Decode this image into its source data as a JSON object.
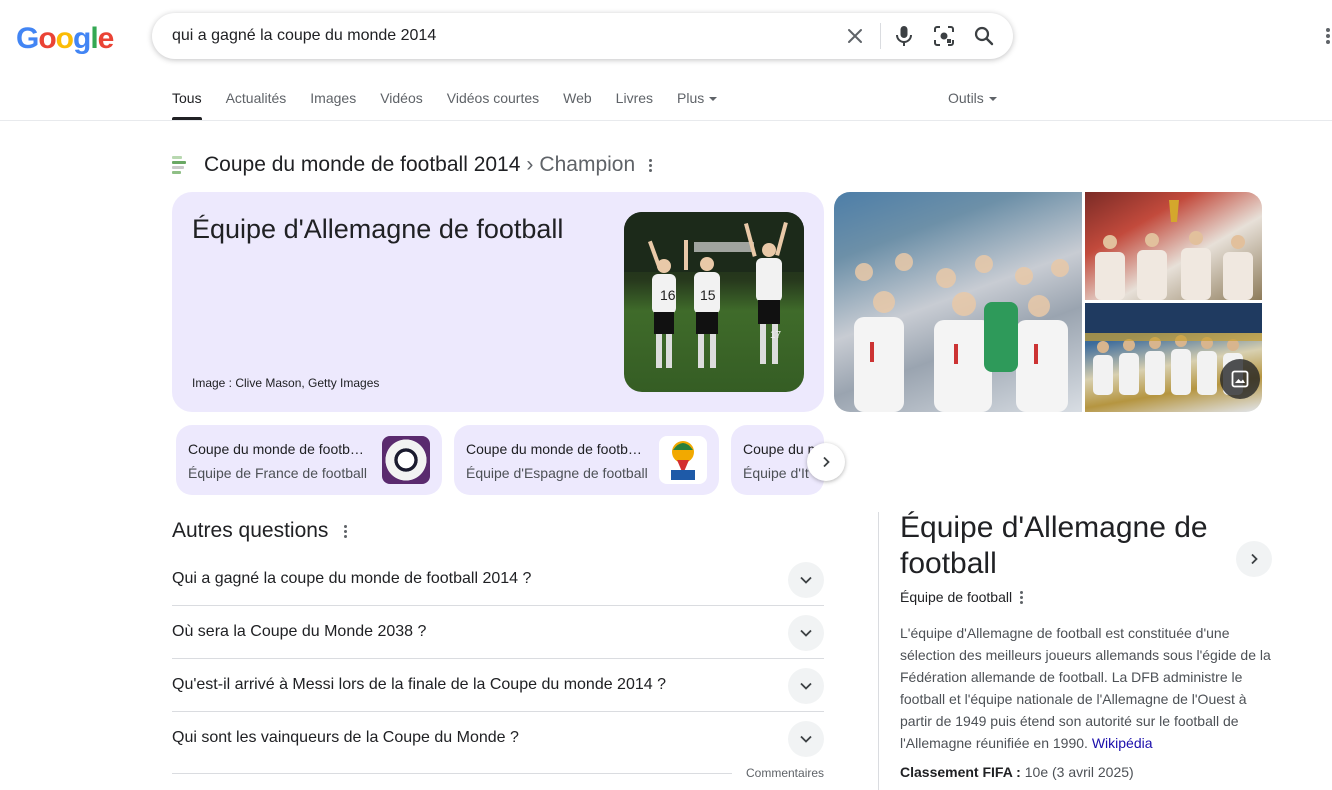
{
  "logo": {
    "letters": [
      "G",
      "o",
      "o",
      "g",
      "l",
      "e"
    ],
    "colors": [
      "#4285f4",
      "#ea4335",
      "#fbbc05",
      "#4285f4",
      "#34a853",
      "#ea4335"
    ]
  },
  "search": {
    "query": "qui a gagné la coupe du monde 2014"
  },
  "tabs": [
    {
      "label": "Tous",
      "active": true
    },
    {
      "label": "Actualités"
    },
    {
      "label": "Images"
    },
    {
      "label": "Vidéos"
    },
    {
      "label": "Vidéos courtes"
    },
    {
      "label": "Web"
    },
    {
      "label": "Livres"
    },
    {
      "label": "Plus"
    }
  ],
  "tools_label": "Outils",
  "topic": {
    "title": "Coupe du monde de football 2014",
    "separator": "›",
    "subtitle": "Champion"
  },
  "answer": {
    "title": "Équipe d'Allemagne de football",
    "credit": "Image : Clive Mason, Getty Images"
  },
  "chips": [
    {
      "line1": "Coupe du monde de footb…",
      "line2": "Équipe de France de football"
    },
    {
      "line1": "Coupe du monde de footb…",
      "line2": "Équipe d'Espagne de football"
    },
    {
      "line1": "Coupe du m",
      "line2": "Équipe d'It"
    }
  ],
  "paa": {
    "title": "Autres questions",
    "questions": [
      "Qui a gagné la coupe du monde de football 2014 ?",
      "Où sera la Coupe du Monde 2038 ?",
      "Qu'est-il arrivé à Messi lors de la finale de la Coupe du monde 2014 ?",
      "Qui sont les vainqueurs de la Coupe du Monde ?"
    ],
    "feedback": "Commentaires"
  },
  "kp": {
    "title": "Équipe d'Allemagne de football",
    "subtitle": "Équipe de football",
    "description": "L'équipe d'Allemagne de football est constituée d'une sélection des meilleurs joueurs allemands sous l'égide de la Fédération allemande de football. La DFB administre le football et l'équipe nationale de l'Allemagne de l'Ouest à partir de 1949 puis étend son autorité sur le football de l'Allemagne réunifiée en 1990.",
    "source": "Wikipédia",
    "fact_label": "Classement FIFA :",
    "fact_value": "10e (3 avril 2025)"
  },
  "icons": [
    "clear-icon",
    "mic-icon",
    "lens-icon",
    "search-icon",
    "apps-icon",
    "more-vert-icon",
    "chevron-right-icon",
    "chevron-down-icon",
    "image-gallery-icon"
  ]
}
